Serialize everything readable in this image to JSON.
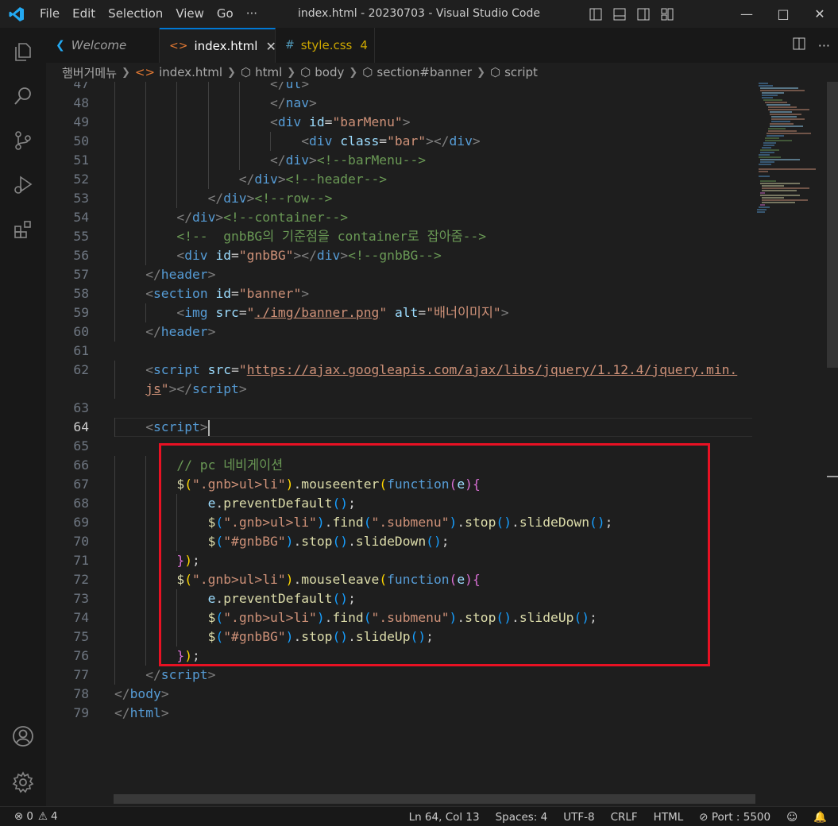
{
  "titlebar": {
    "menu": [
      "File",
      "Edit",
      "Selection",
      "View",
      "Go",
      "···"
    ],
    "title": "index.html - 20230703 - Visual Studio Code"
  },
  "tabs": [
    {
      "label": "Welcome",
      "icon": "vscode-icon",
      "active": false
    },
    {
      "label": "index.html",
      "icon": "html-icon",
      "active": true,
      "close": "✕"
    },
    {
      "label": "style.css",
      "icon": "css-icon",
      "active": false,
      "badge": "4"
    }
  ],
  "breadcrumb": [
    "햄버거메뉴",
    "index.html",
    "html",
    "body",
    "section#banner",
    "script"
  ],
  "editor": {
    "current_line": "64",
    "lines": [
      {
        "n": "47",
        "tokens": [
          [
            "t-br",
            "</"
          ],
          [
            "t-tag",
            "ul"
          ],
          [
            "t-br",
            ">"
          ]
        ],
        "indent": 10
      },
      {
        "n": "48",
        "tokens": [
          [
            "t-br",
            "</"
          ],
          [
            "t-tag",
            "nav"
          ],
          [
            "t-br",
            ">"
          ]
        ],
        "indent": 10
      },
      {
        "n": "49",
        "tokens": [
          [
            "t-br",
            "<"
          ],
          [
            "t-tag",
            "div"
          ],
          [
            "t-txt",
            " "
          ],
          [
            "t-att",
            "id"
          ],
          [
            "t-txt",
            "="
          ],
          [
            "t-str",
            "\"barMenu\""
          ],
          [
            "t-br",
            ">"
          ]
        ],
        "indent": 10
      },
      {
        "n": "50",
        "tokens": [
          [
            "t-br",
            "<"
          ],
          [
            "t-tag",
            "div"
          ],
          [
            "t-txt",
            " "
          ],
          [
            "t-att",
            "class"
          ],
          [
            "t-txt",
            "="
          ],
          [
            "t-str",
            "\"bar\""
          ],
          [
            "t-br",
            "></"
          ],
          [
            "t-tag",
            "div"
          ],
          [
            "t-br",
            ">"
          ]
        ],
        "indent": 12
      },
      {
        "n": "51",
        "tokens": [
          [
            "t-br",
            "</"
          ],
          [
            "t-tag",
            "div"
          ],
          [
            "t-br",
            ">"
          ],
          [
            "t-com",
            "<!--barMenu-->"
          ]
        ],
        "indent": 10
      },
      {
        "n": "52",
        "tokens": [
          [
            "t-br",
            "</"
          ],
          [
            "t-tag",
            "div"
          ],
          [
            "t-br",
            ">"
          ],
          [
            "t-com",
            "<!--header-->"
          ]
        ],
        "indent": 8
      },
      {
        "n": "53",
        "tokens": [
          [
            "t-br",
            "</"
          ],
          [
            "t-tag",
            "div"
          ],
          [
            "t-br",
            ">"
          ],
          [
            "t-com",
            "<!--row-->"
          ]
        ],
        "indent": 6
      },
      {
        "n": "54",
        "tokens": [
          [
            "t-br",
            "</"
          ],
          [
            "t-tag",
            "div"
          ],
          [
            "t-br",
            ">"
          ],
          [
            "t-com",
            "<!--container-->"
          ]
        ],
        "indent": 4
      },
      {
        "n": "55",
        "tokens": [
          [
            "t-com",
            "<!--  gnbBG의 기준점을 container로 잡아줌-->"
          ]
        ],
        "indent": 4
      },
      {
        "n": "56",
        "tokens": [
          [
            "t-br",
            "<"
          ],
          [
            "t-tag",
            "div"
          ],
          [
            "t-txt",
            " "
          ],
          [
            "t-att",
            "id"
          ],
          [
            "t-txt",
            "="
          ],
          [
            "t-str",
            "\"gnbBG\""
          ],
          [
            "t-br",
            "></"
          ],
          [
            "t-tag",
            "div"
          ],
          [
            "t-br",
            ">"
          ],
          [
            "t-com",
            "<!--gnbBG-->"
          ]
        ],
        "indent": 4
      },
      {
        "n": "57",
        "tokens": [
          [
            "t-br",
            "</"
          ],
          [
            "t-tag",
            "header"
          ],
          [
            "t-br",
            ">"
          ]
        ],
        "indent": 2
      },
      {
        "n": "58",
        "tokens": [
          [
            "t-br",
            "<"
          ],
          [
            "t-tag",
            "section"
          ],
          [
            "t-txt",
            " "
          ],
          [
            "t-att",
            "id"
          ],
          [
            "t-txt",
            "="
          ],
          [
            "t-str",
            "\"banner\""
          ],
          [
            "t-br",
            ">"
          ]
        ],
        "indent": 2
      },
      {
        "n": "59",
        "tokens": [
          [
            "t-br",
            "<"
          ],
          [
            "t-tag",
            "img"
          ],
          [
            "t-txt",
            " "
          ],
          [
            "t-att",
            "src"
          ],
          [
            "t-txt",
            "="
          ],
          [
            "t-str",
            "\""
          ],
          [
            "t-url",
            "./img/banner.png"
          ],
          [
            "t-str",
            "\""
          ],
          [
            "t-txt",
            " "
          ],
          [
            "t-att",
            "alt"
          ],
          [
            "t-txt",
            "="
          ],
          [
            "t-str",
            "\"배너이미지\""
          ],
          [
            "t-br",
            ">"
          ]
        ],
        "indent": 4
      },
      {
        "n": "60",
        "tokens": [
          [
            "t-br",
            "</"
          ],
          [
            "t-tag",
            "header"
          ],
          [
            "t-br",
            ">"
          ]
        ],
        "indent": 2
      },
      {
        "n": "61",
        "tokens": [],
        "indent": 0
      },
      {
        "n": "62",
        "tokens": [
          [
            "t-br",
            "<"
          ],
          [
            "t-tag",
            "script"
          ],
          [
            "t-txt",
            " "
          ],
          [
            "t-att",
            "src"
          ],
          [
            "t-txt",
            "="
          ],
          [
            "t-str",
            "\""
          ],
          [
            "t-url",
            "https://ajax.googleapis.com/ajax/libs/jquery/1.12.4/jquery.min."
          ]
        ],
        "indent": 2
      },
      {
        "n": "",
        "tokens": [
          [
            "t-url",
            "js"
          ],
          [
            "t-str",
            "\""
          ],
          [
            "t-br",
            "></"
          ],
          [
            "t-tag",
            "script"
          ],
          [
            "t-br",
            ">"
          ]
        ],
        "indent": 2
      },
      {
        "n": "63",
        "tokens": [],
        "indent": 0
      },
      {
        "n": "64",
        "tokens": [
          [
            "t-br",
            "<"
          ],
          [
            "t-tag",
            "script"
          ],
          [
            "t-br",
            ">"
          ]
        ],
        "indent": 2,
        "caret": true
      },
      {
        "n": "65",
        "tokens": [],
        "indent": 0
      },
      {
        "n": "66",
        "tokens": [
          [
            "t-com",
            "// pc 네비게이션"
          ]
        ],
        "indent": 4
      },
      {
        "n": "67",
        "tokens": [
          [
            "t-fn",
            "$"
          ],
          [
            "t-p1",
            "("
          ],
          [
            "t-str",
            "\".gnb>ul>li\""
          ],
          [
            "t-p1",
            ")"
          ],
          [
            "t-txt",
            "."
          ],
          [
            "t-fn",
            "mouseenter"
          ],
          [
            "t-p1",
            "("
          ],
          [
            "t-kw",
            "function"
          ],
          [
            "t-p2",
            "("
          ],
          [
            "t-att",
            "e"
          ],
          [
            "t-p2",
            ")"
          ],
          [
            "t-p2",
            "{"
          ]
        ],
        "indent": 4
      },
      {
        "n": "68",
        "tokens": [
          [
            "t-att",
            "e"
          ],
          [
            "t-txt",
            "."
          ],
          [
            "t-fn",
            "preventDefault"
          ],
          [
            "t-p3",
            "()"
          ],
          [
            "t-txt",
            ";"
          ]
        ],
        "indent": 6
      },
      {
        "n": "69",
        "tokens": [
          [
            "t-fn",
            "$"
          ],
          [
            "t-p3",
            "("
          ],
          [
            "t-str",
            "\".gnb>ul>li\""
          ],
          [
            "t-p3",
            ")"
          ],
          [
            "t-txt",
            "."
          ],
          [
            "t-fn",
            "find"
          ],
          [
            "t-p3",
            "("
          ],
          [
            "t-str",
            "\".submenu\""
          ],
          [
            "t-p3",
            ")"
          ],
          [
            "t-txt",
            "."
          ],
          [
            "t-fn",
            "stop"
          ],
          [
            "t-p3",
            "()"
          ],
          [
            "t-txt",
            "."
          ],
          [
            "t-fn",
            "slideDown"
          ],
          [
            "t-p3",
            "()"
          ],
          [
            "t-txt",
            ";"
          ]
        ],
        "indent": 6
      },
      {
        "n": "70",
        "tokens": [
          [
            "t-fn",
            "$"
          ],
          [
            "t-p3",
            "("
          ],
          [
            "t-str",
            "\"#gnbBG\""
          ],
          [
            "t-p3",
            ")"
          ],
          [
            "t-txt",
            "."
          ],
          [
            "t-fn",
            "stop"
          ],
          [
            "t-p3",
            "()"
          ],
          [
            "t-txt",
            "."
          ],
          [
            "t-fn",
            "slideDown"
          ],
          [
            "t-p3",
            "()"
          ],
          [
            "t-txt",
            ";"
          ]
        ],
        "indent": 6
      },
      {
        "n": "71",
        "tokens": [
          [
            "t-p2",
            "}"
          ],
          [
            "t-p1",
            ")"
          ],
          [
            "t-txt",
            ";"
          ]
        ],
        "indent": 4
      },
      {
        "n": "72",
        "tokens": [
          [
            "t-fn",
            "$"
          ],
          [
            "t-p1",
            "("
          ],
          [
            "t-str",
            "\".gnb>ul>li\""
          ],
          [
            "t-p1",
            ")"
          ],
          [
            "t-txt",
            "."
          ],
          [
            "t-fn",
            "mouseleave"
          ],
          [
            "t-p1",
            "("
          ],
          [
            "t-kw",
            "function"
          ],
          [
            "t-p2",
            "("
          ],
          [
            "t-att",
            "e"
          ],
          [
            "t-p2",
            ")"
          ],
          [
            "t-p2",
            "{"
          ]
        ],
        "indent": 4
      },
      {
        "n": "73",
        "tokens": [
          [
            "t-att",
            "e"
          ],
          [
            "t-txt",
            "."
          ],
          [
            "t-fn",
            "preventDefault"
          ],
          [
            "t-p3",
            "()"
          ],
          [
            "t-txt",
            ";"
          ]
        ],
        "indent": 6
      },
      {
        "n": "74",
        "tokens": [
          [
            "t-fn",
            "$"
          ],
          [
            "t-p3",
            "("
          ],
          [
            "t-str",
            "\".gnb>ul>li\""
          ],
          [
            "t-p3",
            ")"
          ],
          [
            "t-txt",
            "."
          ],
          [
            "t-fn",
            "find"
          ],
          [
            "t-p3",
            "("
          ],
          [
            "t-str",
            "\".submenu\""
          ],
          [
            "t-p3",
            ")"
          ],
          [
            "t-txt",
            "."
          ],
          [
            "t-fn",
            "stop"
          ],
          [
            "t-p3",
            "()"
          ],
          [
            "t-txt",
            "."
          ],
          [
            "t-fn",
            "slideUp"
          ],
          [
            "t-p3",
            "()"
          ],
          [
            "t-txt",
            ";"
          ]
        ],
        "indent": 6
      },
      {
        "n": "75",
        "tokens": [
          [
            "t-fn",
            "$"
          ],
          [
            "t-p3",
            "("
          ],
          [
            "t-str",
            "\"#gnbBG\""
          ],
          [
            "t-p3",
            ")"
          ],
          [
            "t-txt",
            "."
          ],
          [
            "t-fn",
            "stop"
          ],
          [
            "t-p3",
            "()"
          ],
          [
            "t-txt",
            "."
          ],
          [
            "t-fn",
            "slideUp"
          ],
          [
            "t-p3",
            "()"
          ],
          [
            "t-txt",
            ";"
          ]
        ],
        "indent": 6
      },
      {
        "n": "76",
        "tokens": [
          [
            "t-p2",
            "}"
          ],
          [
            "t-p1",
            ")"
          ],
          [
            "t-txt",
            ";"
          ]
        ],
        "indent": 4
      },
      {
        "n": "77",
        "tokens": [
          [
            "t-br",
            "</"
          ],
          [
            "t-tag",
            "script"
          ],
          [
            "t-br",
            ">"
          ]
        ],
        "indent": 2
      },
      {
        "n": "78",
        "tokens": [
          [
            "t-br",
            "</"
          ],
          [
            "t-tag",
            "body"
          ],
          [
            "t-br",
            ">"
          ]
        ],
        "indent": 0
      },
      {
        "n": "79",
        "tokens": [
          [
            "t-br",
            "</"
          ],
          [
            "t-tag",
            "html"
          ],
          [
            "t-br",
            ">"
          ]
        ],
        "indent": 0
      }
    ]
  },
  "statusbar": {
    "errors": "0",
    "warnings": "4",
    "position": "Ln 64, Col 13",
    "spaces": "Spaces: 4",
    "encoding": "UTF-8",
    "eol": "CRLF",
    "language": "HTML",
    "port": "Port : 5500"
  },
  "colors": {
    "accent": "#0078d4",
    "highlight_box": "#e81123"
  }
}
